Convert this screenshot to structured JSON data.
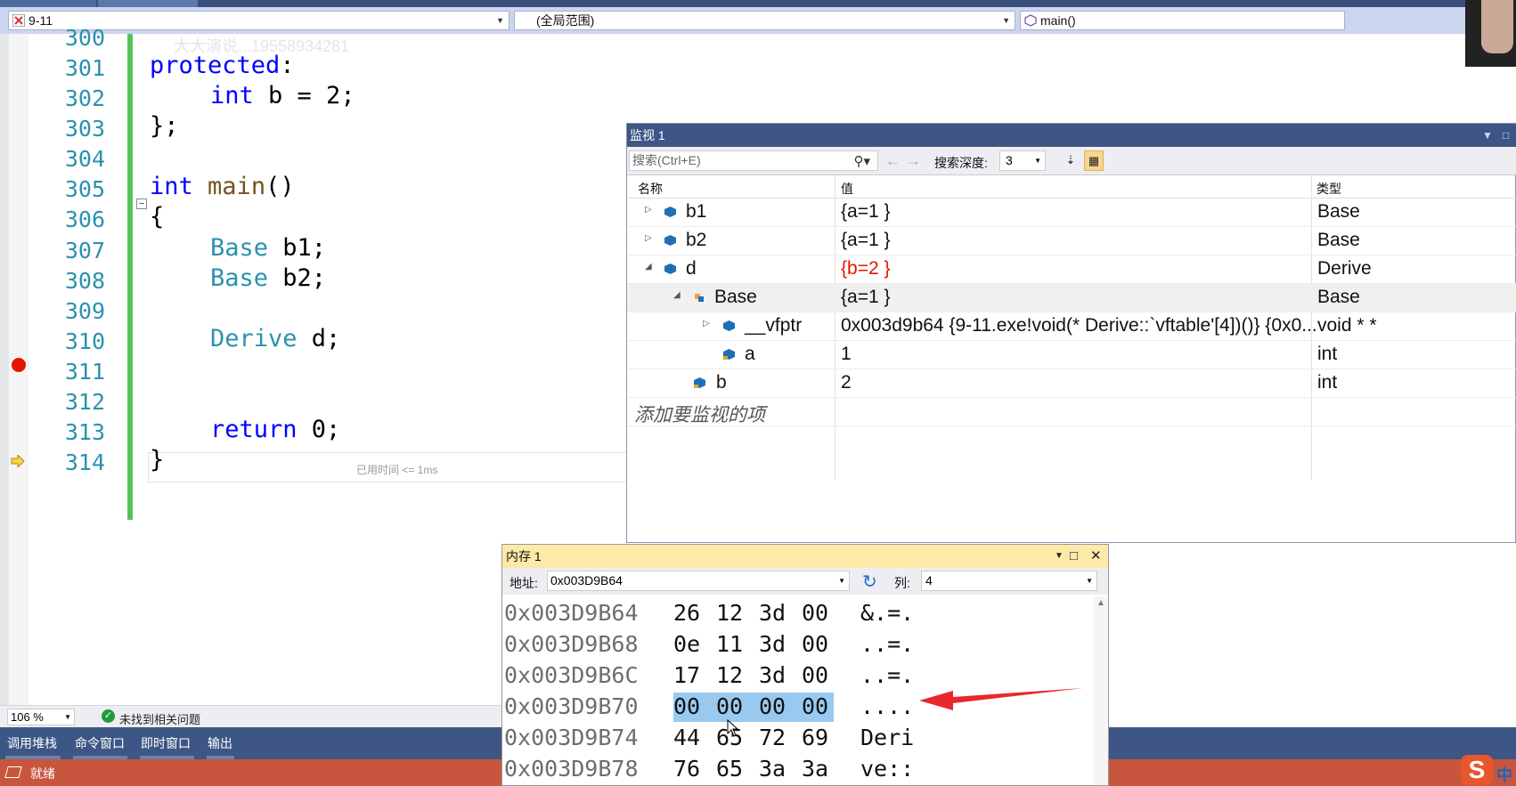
{
  "toolbar": {
    "project_combo": "9-11",
    "scope_combo": "(全局范围)",
    "function_combo": "main()"
  },
  "editor": {
    "watermark": "大大演说...19558934281",
    "line_numbers": [
      "300",
      "301",
      "302",
      "303",
      "304",
      "305",
      "306",
      "307",
      "308",
      "309",
      "310",
      "311",
      "312",
      "313",
      "314"
    ],
    "code": {
      "l301_kw": "protected",
      "l301_rest": ":",
      "l302_kw": "int",
      "l302_rest": " b = 2;",
      "l303": "};",
      "l305_kw": "int",
      "l305_fn": "main",
      "l305_rest": "()",
      "l306": "{",
      "l307_ty": "Base",
      "l307_rest": " b1;",
      "l308_ty": "Base",
      "l308_rest": " b2;",
      "l310_ty": "Derive",
      "l310_rest": " d;",
      "l313_kw": "return",
      "l313_rest": " 0;",
      "l314": "}"
    },
    "elapsed": "已用时间 <= 1ms"
  },
  "status": {
    "zoom": "106 %",
    "issues": "未找到相关问题",
    "ready": "就绪"
  },
  "panel_tabs": [
    "调用堆栈",
    "命令窗口",
    "即时窗口",
    "输出"
  ],
  "watch": {
    "title": "监视 1",
    "search_placeholder": "搜索(Ctrl+E)",
    "depth_label": "搜索深度:",
    "depth_value": "3",
    "headers": {
      "name": "名称",
      "value": "值",
      "type": "类型"
    },
    "rows": [
      {
        "name": "b1",
        "value": "{a=1 }",
        "type": "Base"
      },
      {
        "name": "b2",
        "value": "{a=1 }",
        "type": "Base"
      },
      {
        "name": "d",
        "value": "{b=2 }",
        "type": "Derive"
      },
      {
        "name": "Base",
        "value": "{a=1 }",
        "type": "Base"
      },
      {
        "name": "__vfptr",
        "value": "0x003d9b64 {9-11.exe!void(* Derive::`vftable'[4])()} {0x0...",
        "type": "void * *"
      },
      {
        "name": "a",
        "value": "1",
        "type": "int"
      },
      {
        "name": "b",
        "value": "2",
        "type": "int"
      }
    ],
    "add_item": "添加要监视的项"
  },
  "memory": {
    "title": "内存 1",
    "addr_label": "地址:",
    "addr_value": "0x003D9B64",
    "cols_label": "列:",
    "cols_value": "4",
    "lines": [
      {
        "addr": "0x003D9B64",
        "b": [
          "26",
          "12",
          "3d",
          "00"
        ],
        "ascii": "&.=."
      },
      {
        "addr": "0x003D9B68",
        "b": [
          "0e",
          "11",
          "3d",
          "00"
        ],
        "ascii": "..=."
      },
      {
        "addr": "0x003D9B6C",
        "b": [
          "17",
          "12",
          "3d",
          "00"
        ],
        "ascii": "..=."
      },
      {
        "addr": "0x003D9B70",
        "b": [
          "00",
          "00",
          "00",
          "00"
        ],
        "ascii": "...."
      },
      {
        "addr": "0x003D9B74",
        "b": [
          "44",
          "65",
          "72",
          "69"
        ],
        "ascii": "Deri"
      },
      {
        "addr": "0x003D9B78",
        "b": [
          "76",
          "65",
          "3a",
          "3a"
        ],
        "ascii": "ve::"
      }
    ]
  },
  "ime": {
    "badge": "中"
  },
  "colors": {
    "accent": "#3d5685",
    "status": "#c8553d",
    "highlight": "#99c9ef",
    "arrow": "#e8282b"
  }
}
